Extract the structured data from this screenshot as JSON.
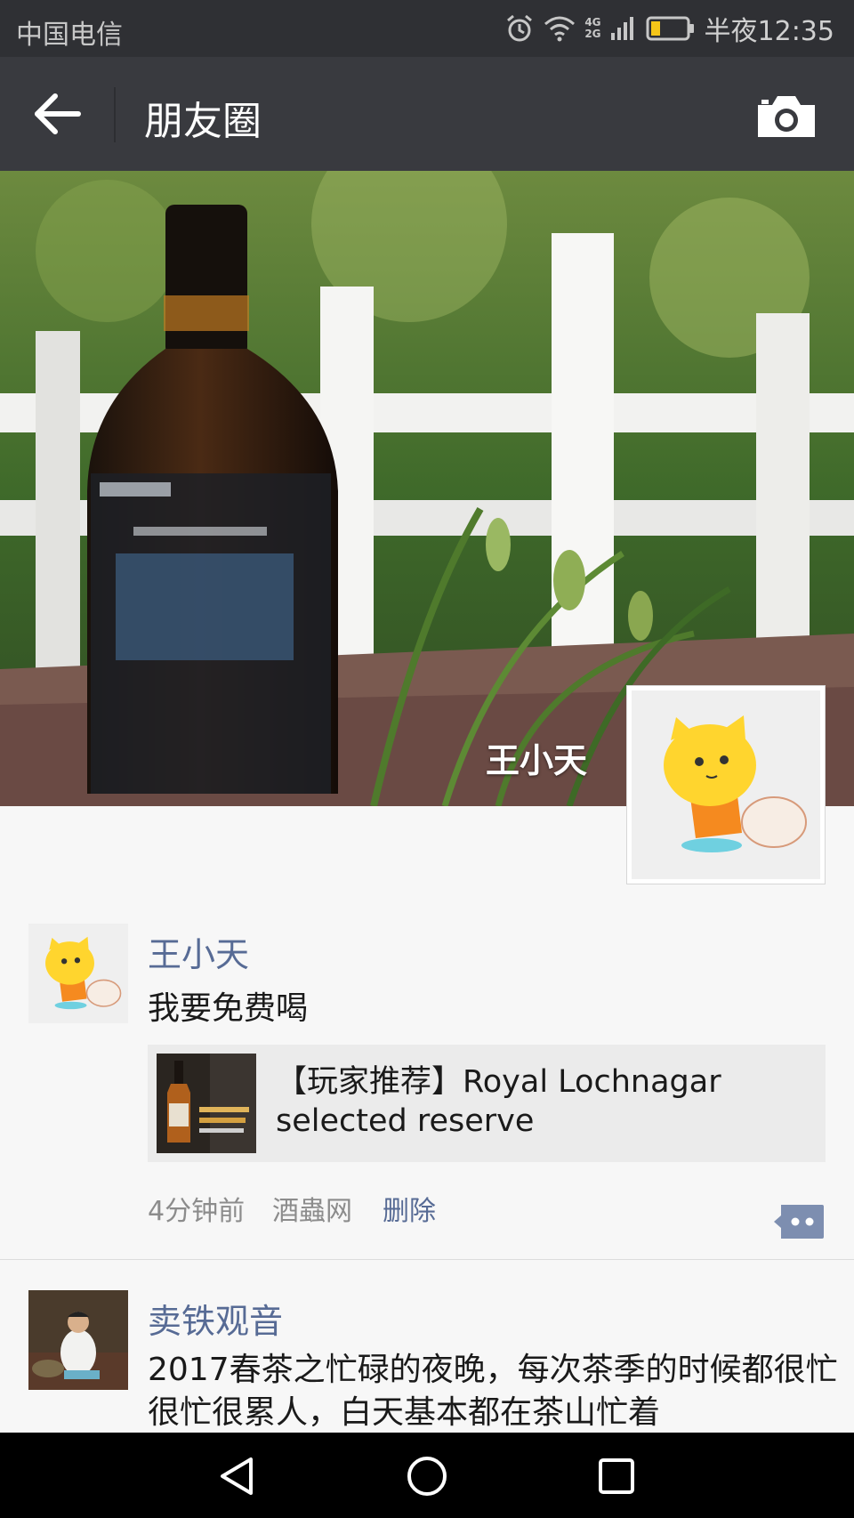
{
  "status_bar": {
    "carrier": "中国电信",
    "network_label_top": "4G",
    "network_label_bottom": "2G",
    "time": "半夜12:35",
    "icons": [
      "alarm-icon",
      "wifi-icon",
      "signal-icon",
      "battery-icon"
    ]
  },
  "nav": {
    "title": "朋友圈",
    "back_icon": "back-arrow-icon",
    "camera_icon": "camera-icon"
  },
  "cover": {
    "user_name": "王小天"
  },
  "posts": [
    {
      "author": "王小天",
      "text": "我要免费喝",
      "link_title": "【玩家推荐】Royal Lochnagar selected reserve",
      "time": "4分钟前",
      "source": "酒蟲网",
      "delete_label": "删除"
    },
    {
      "author": "卖铁观音",
      "text": "2017春茶之忙碌的夜晚，每次茶季的时候都很忙很忙很累人，白天基本都在茶山忙着"
    }
  ],
  "colors": {
    "accent_link": "#576b95",
    "nav_bg": "#393a3f",
    "status_bg": "#2f3034"
  }
}
